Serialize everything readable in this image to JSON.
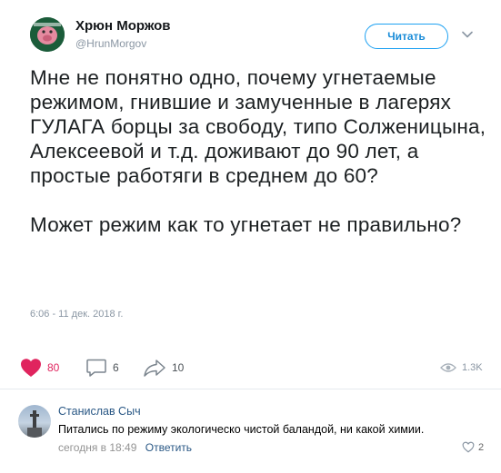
{
  "tweet": {
    "author": {
      "name": "Хрюн Моржов",
      "handle": "@HrunMorgov"
    },
    "follow_label": "Читать",
    "text": {
      "paragraph1": "Мне не понятно одно, почему угнетаемые режимом, гнившие и замученные в лагерях ГУЛАГА борцы за свободу, типо Солженицына, Алексеевой и т.д. доживают до 90 лет, а простые работяги в среднем до 60?",
      "paragraph2": "Может режим как то угнетает не правильно?"
    },
    "timestamp": "6:06 - 11 дек. 2018 г."
  },
  "actions": {
    "likes": "80",
    "comments": "6",
    "shares": "10",
    "views": "1.3K"
  },
  "comment": {
    "author": "Станислав Сыч",
    "text": "Питались по режиму экологическо чистой баландой, ни какой химии.",
    "time": "сегодня в 18:49",
    "reply_label": "Ответить",
    "likes": "2"
  },
  "colors": {
    "accent": "#1da1f2",
    "like": "#e0245e",
    "link": "#2a5885",
    "muted": "#8a96a3"
  }
}
